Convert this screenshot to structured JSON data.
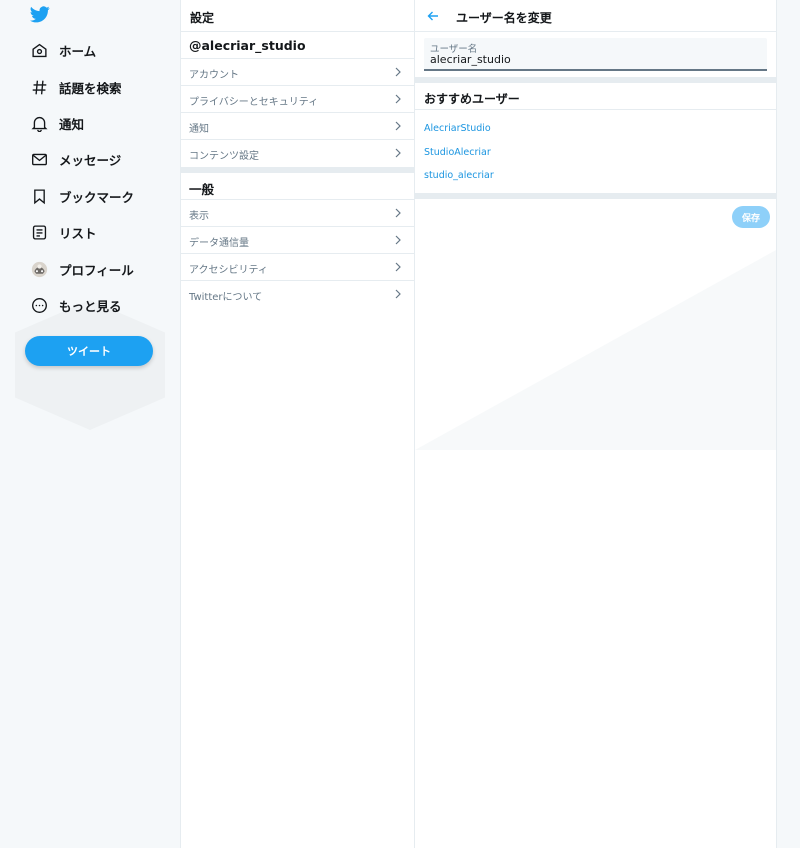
{
  "nav": {
    "logo_icon": "twitter-bird-icon",
    "items": [
      {
        "label": "ホーム",
        "icon": "home-icon"
      },
      {
        "label": "話題を検索",
        "icon": "hashtag-icon"
      },
      {
        "label": "通知",
        "icon": "bell-icon"
      },
      {
        "label": "メッセージ",
        "icon": "envelope-icon"
      },
      {
        "label": "ブックマーク",
        "icon": "bookmark-icon"
      },
      {
        "label": "リスト",
        "icon": "list-icon"
      },
      {
        "label": "プロフィール",
        "icon": "avatar-icon"
      },
      {
        "label": "もっと見る",
        "icon": "more-icon"
      }
    ],
    "tweet_button": "ツイート"
  },
  "settings": {
    "title": "設定",
    "handle": "@alecriar_studio",
    "account_items": [
      "アカウント",
      "プライバシーとセキュリティ",
      "通知",
      "コンテンツ設定"
    ],
    "general_header": "一般",
    "general_items": [
      "表示",
      "データ通信量",
      "アクセシビリティ",
      "Twitterについて"
    ]
  },
  "edit": {
    "title": "ユーザー名を変更",
    "field_label": "ユーザー名",
    "field_value": "alecriar_studio",
    "suggest_header": "おすすめユーザー",
    "suggestions": [
      "AlecriarStudio",
      "StudioAlecriar",
      "studio_alecriar"
    ],
    "save_button": "保存"
  },
  "colors": {
    "accent": "#1da1f2",
    "link": "#1b95e0",
    "save_disabled": "#8ed0f9",
    "nav_bg": "#f5f8fa",
    "divider": "#e6ecf0"
  }
}
